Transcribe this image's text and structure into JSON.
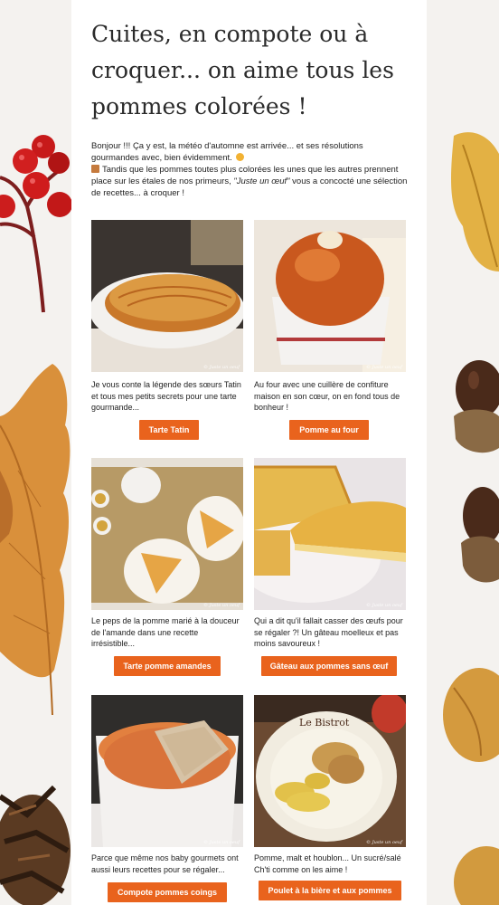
{
  "article": {
    "title": "Cuites, en compote ou à croquer... on aime tous les pommes colorées !",
    "intro_line1": "Bonjour  !!! Ça y est, la météo d'automne est arrivée... et ses résolutions gourmandes avec, bien évidemment. ",
    "intro_line2_a": "Tandis que les pommes toutes plus colorées les unes que les autres prennent place sur les étales de nos primeurs, ",
    "intro_line2_em": "\"Juste un œuf\"",
    "intro_line2_b": " vous a concocté une sélection de recettes... à croquer !",
    "watermark": "© Juste un oeuf"
  },
  "recipes": [
    {
      "description": "Je vous conte la légende des sœurs Tatin et tous mes petits secrets pour une tarte gourmande...",
      "button": "Tarte Tatin"
    },
    {
      "description": "Au four avec une cuillère de confiture maison en son cœur, on en fond tous de bonheur !",
      "button": "Pomme au four"
    },
    {
      "description": "Le peps de la pomme marié à la douceur de l'amande dans une recette irrésistible...",
      "button": "Tarte pomme amandes"
    },
    {
      "description": "Qui a dit qu'il fallait casser des œufs pour se régaler ?! Un gâteau moelleux et pas moins savoureux !",
      "button": "Gâteau aux pommes sans œuf"
    },
    {
      "description": "Parce que même nos baby gourmets ont aussi leurs recettes pour se régaler...",
      "button": "Compote pommes coings"
    },
    {
      "description": "Pomme, malt et houblon... Un sucré/salé Ch'ti comme on les aime !",
      "button": "Poulet à la bière et aux pommes",
      "plate_text": "Le Bistrot"
    }
  ],
  "colors": {
    "button": "#e9631d",
    "background": "#f4f2ef",
    "text": "#222222"
  },
  "icons": {
    "smile": "smiling-face-emoji",
    "gift": "package-emoji"
  }
}
